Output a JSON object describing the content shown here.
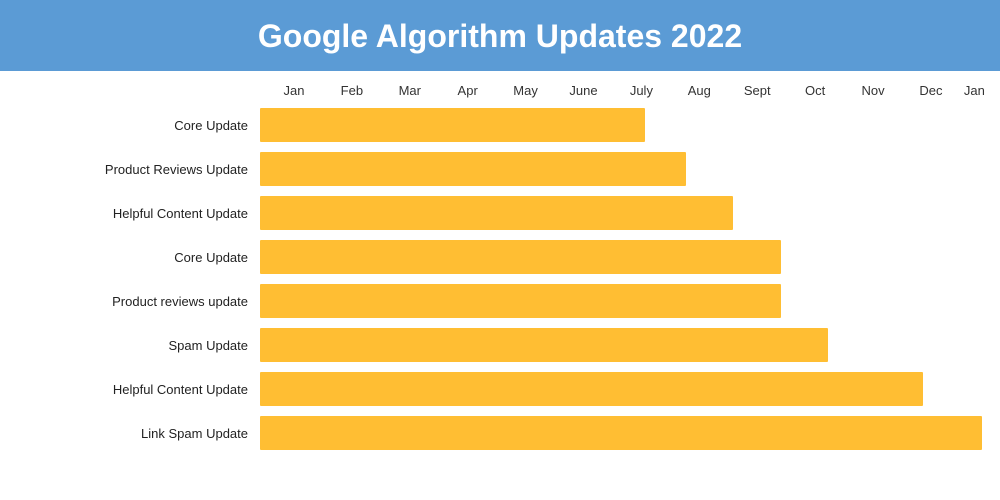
{
  "header": {
    "title": "Google Algorithm Updates 2022"
  },
  "months": [
    {
      "label": "Jan",
      "width": 58
    },
    {
      "label": "Feb",
      "width": 52
    },
    {
      "label": "Mar",
      "width": 58
    },
    {
      "label": "Apr",
      "width": 52
    },
    {
      "label": "May",
      "width": 52
    },
    {
      "label": "June",
      "width": 58
    },
    {
      "label": "July",
      "width": 52
    },
    {
      "label": "Aug",
      "width": 52
    },
    {
      "label": "Sept",
      "width": 58
    },
    {
      "label": "Oct",
      "width": 52
    },
    {
      "label": "Nov",
      "width": 52
    },
    {
      "label": "Dec",
      "width": 52
    },
    {
      "label": "Jan",
      "width": 52
    }
  ],
  "rows": [
    {
      "label": "Core Update",
      "bar_start": 0,
      "bar_end": 6.5
    },
    {
      "label": "Product Reviews Update",
      "bar_start": 0,
      "bar_end": 7.2
    },
    {
      "label": "Helpful Content Update",
      "bar_start": 0,
      "bar_end": 8.0
    },
    {
      "label": "Core Update",
      "bar_start": 0,
      "bar_end": 8.8
    },
    {
      "label": "Product reviews update",
      "bar_start": 0,
      "bar_end": 8.8
    },
    {
      "label": "Spam Update",
      "bar_start": 0,
      "bar_end": 9.6
    },
    {
      "label": "Helpful Content Update",
      "bar_start": 0,
      "bar_end": 11.2
    },
    {
      "label": "Link Spam Update",
      "bar_start": 0,
      "bar_end": 12.2
    }
  ],
  "bar_color": "#FFBE33",
  "total_months": 13
}
